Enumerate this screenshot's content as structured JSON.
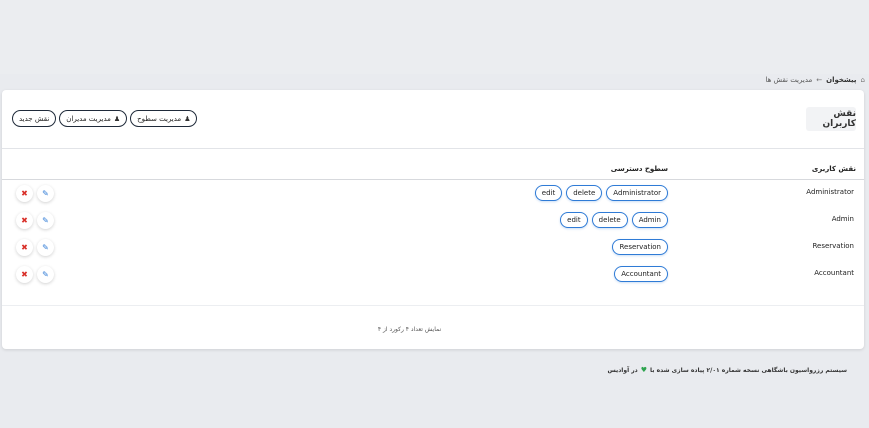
{
  "breadcrumb": {
    "home_label": "پیشخوان",
    "separator": "←",
    "current": "مدیریت نقش ها"
  },
  "card": {
    "title": "نقش کاربران",
    "buttons": [
      {
        "label": "مدیریت سطوح",
        "icon": "users-icon"
      },
      {
        "label": "مدیریت مدیران",
        "icon": "users-icon"
      },
      {
        "label": "نقش جدید",
        "icon": ""
      }
    ]
  },
  "table": {
    "columns": [
      "نقش کاربری",
      "سطوح دسترسی"
    ],
    "rows": [
      {
        "role": "Administrator",
        "permissions": [
          "Administrator",
          "delete",
          "edit"
        ]
      },
      {
        "role": "Admin",
        "permissions": [
          "Admin",
          "delete",
          "edit"
        ]
      },
      {
        "role": "Reservation",
        "permissions": [
          "Reservation"
        ]
      },
      {
        "role": "Accountant",
        "permissions": [
          "Accountant"
        ]
      }
    ],
    "summary": "نمایش تعداد ۴ رکورد از ۴"
  },
  "footer": {
    "text_before": "سیستم رزرواسیون باشگاهی نسخه شماره ۲/۰۱ پیاده سازی شده با",
    "text_after": "در آوادیس"
  },
  "colors": {
    "accent": "#2f7bd6",
    "danger": "#d9312a",
    "heart": "#2ea44f"
  }
}
